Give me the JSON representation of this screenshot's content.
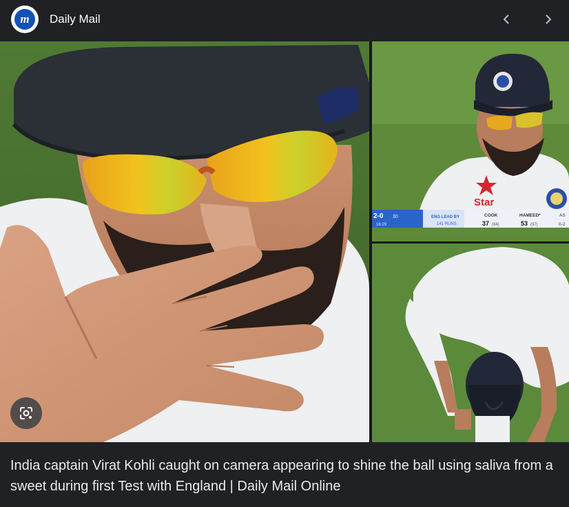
{
  "header": {
    "source_name": "Daily Mail",
    "logo_letter": "m",
    "prev_icon": "chevron-left-icon",
    "next_icon": "chevron-right-icon"
  },
  "image": {
    "scorebar": {
      "series": "2-0",
      "overs": "30",
      "lead_label": "ENG LEAD BY",
      "lead_value": "141 RUNS",
      "batsman1_name": "COOK",
      "batsman1_runs": "37",
      "batsman1_balls": "(84)",
      "batsman2_name": "HAMEED*",
      "batsman2_runs": "53",
      "batsman2_balls": "(97)",
      "time": "16:29",
      "cut_text": "AS",
      "cut_text2": "0-2"
    },
    "sponsor_text": "Star",
    "lens_icon": "google-lens-icon"
  },
  "caption": "India captain Virat Kohli caught on camera appearing to shine the ball using saliva from a sweet during first Test with England | Daily Mail Online",
  "colors": {
    "background": "#202124",
    "logo_blue": "#1452b8",
    "grass": "#5e8a3a",
    "shirt": "#eef0f2",
    "cap": "#2b2f36"
  }
}
